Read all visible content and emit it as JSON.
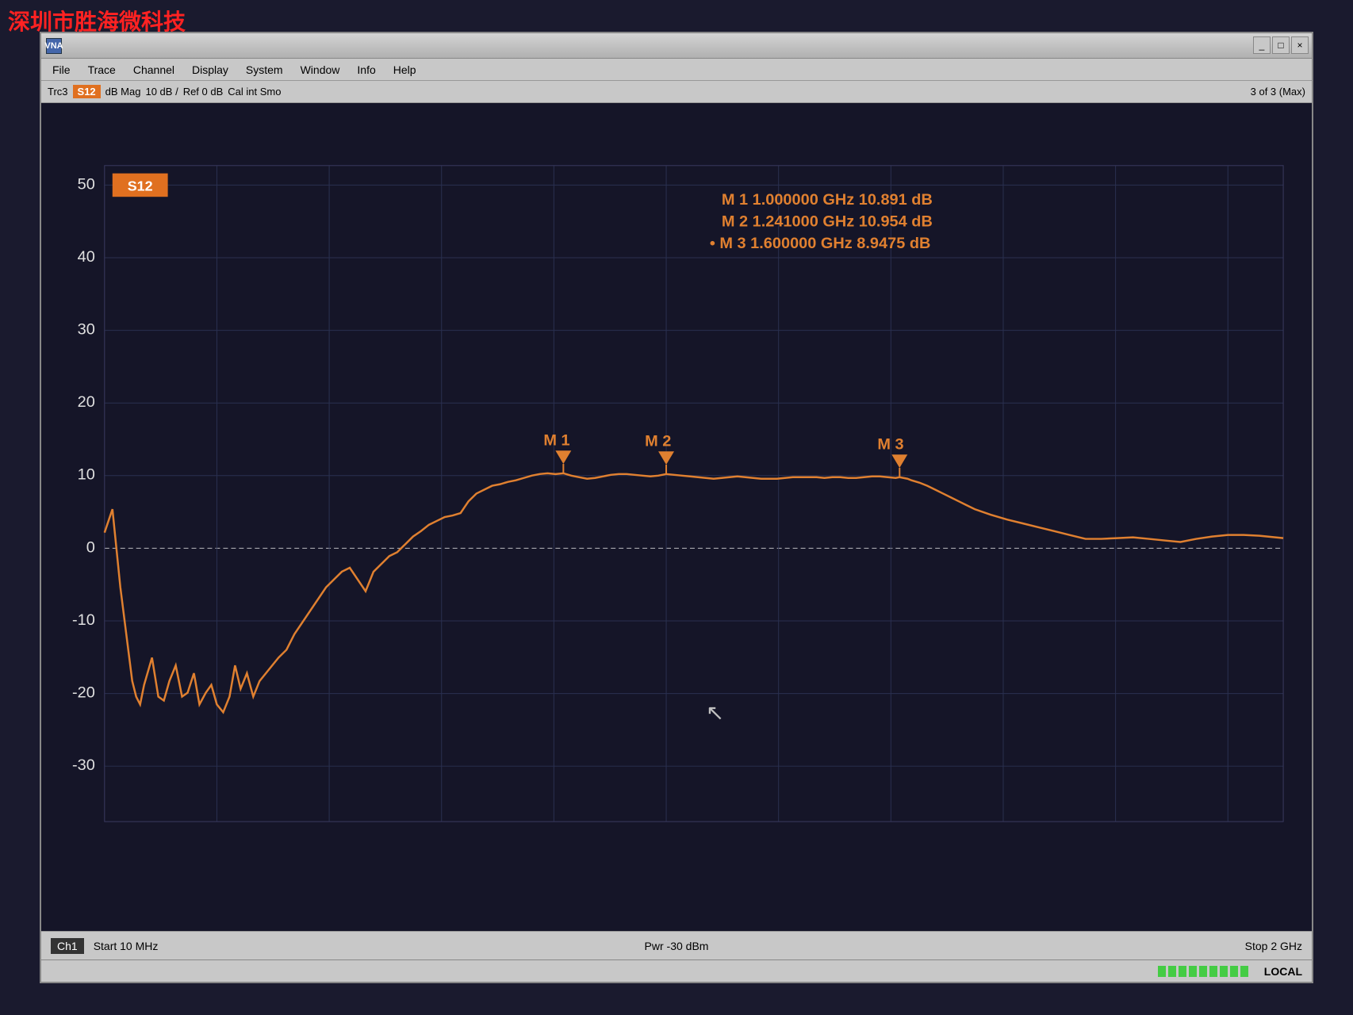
{
  "watermark": "深圳市胜海微科技",
  "window": {
    "icon": "VNA",
    "controls": [
      "_",
      "□",
      "×"
    ]
  },
  "menu": {
    "items": [
      "File",
      "Trace",
      "Channel",
      "Display",
      "System",
      "Window",
      "Info",
      "Help"
    ]
  },
  "tracebar": {
    "trace_label": "Trc3",
    "s_param": "S12",
    "format": "dB Mag",
    "scale": "10 dB /",
    "ref": "Ref 0 dB",
    "cal": "Cal int Smo",
    "right": "3 of 3 (Max)"
  },
  "s12_badge": "S12",
  "markers": [
    {
      "id": "M 1",
      "freq": "1.000000 GHz",
      "value": "10.891 dB"
    },
    {
      "id": "M 2",
      "freq": "1.241000 GHz",
      "value": "10.954 dB"
    },
    {
      "id": "M 3",
      "freq": "1.600000 GHz",
      "value": "8.9475 dB"
    }
  ],
  "statusbar": {
    "channel": "Ch1",
    "start": "Start  10 MHz",
    "power": "Pwr  -30 dBm",
    "stop": "Stop  2 GHz"
  },
  "bottombar": {
    "local": "LOCAL",
    "signal_count": 9
  },
  "chart": {
    "y_labels": [
      "50",
      "40",
      "30",
      "20",
      "10",
      "0",
      "-10",
      "-20",
      "-30"
    ],
    "grid_color": "#2a2a50",
    "trace_color": "#e08030",
    "accent_color": "#ff8800"
  }
}
